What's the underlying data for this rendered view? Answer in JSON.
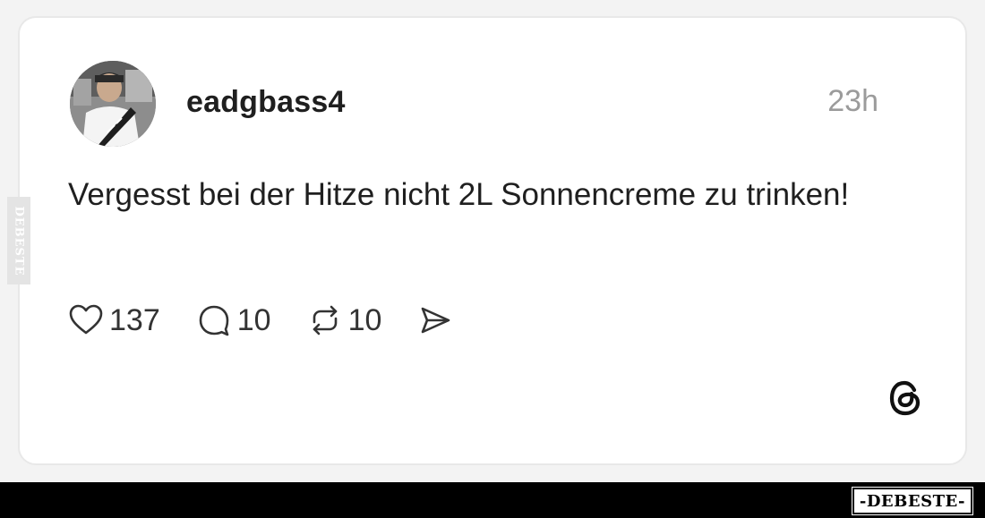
{
  "post": {
    "username": "eadgbass4",
    "timestamp": "23h",
    "text": "Vergesst bei der Hitze nicht 2L Sonnencreme zu trinken!",
    "actions": {
      "like_count": "137",
      "reply_count": "10",
      "repost_count": "10"
    }
  },
  "watermark": {
    "side_text": "DEBESTE",
    "footer_text": "-DEBESTE-"
  },
  "icons": {
    "like": "heart-icon",
    "reply": "comment-bubble-icon",
    "repost": "repost-arrows-icon",
    "share": "send-icon",
    "platform": "threads-logo-icon"
  },
  "colors": {
    "text": "#1f1f1f",
    "muted": "#9b9b9b",
    "card_border": "#e8e8e8",
    "footer": "#000000"
  }
}
